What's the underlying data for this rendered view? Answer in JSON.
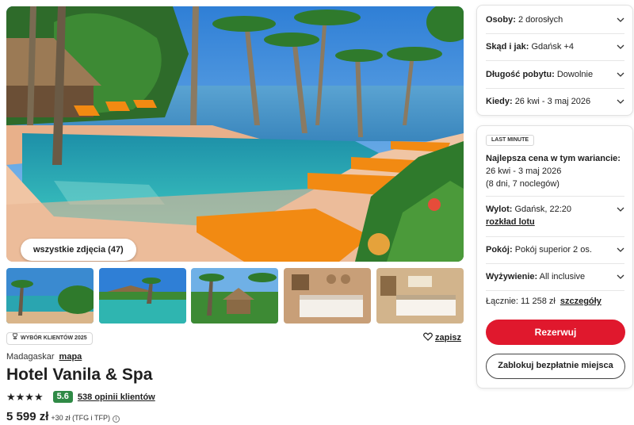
{
  "gallery": {
    "all_photos_label": "wszystkie zdjęcia (47)"
  },
  "badge": {
    "label": "WYBÓR KLIENTÓW 2025",
    "icon": "trophy-icon"
  },
  "save": {
    "label": "zapisz",
    "icon": "heart-icon"
  },
  "location": {
    "country": "Madagaskar",
    "map_link": "mapa"
  },
  "hotel": {
    "name": "Hotel Vanila & Spa",
    "stars": 4,
    "stars_text": "★★★★",
    "score": "5.6",
    "reviews_label": "538 opinii klientów"
  },
  "price": {
    "main": "5 599 zł",
    "extra": "+30 zł (TFG i TFP)",
    "info_icon": "info-icon"
  },
  "search": {
    "rows": [
      {
        "label": "Osoby:",
        "value": "2 dorosłych"
      },
      {
        "label": "Skąd i jak:",
        "value": "Gdańsk +4"
      },
      {
        "label": "Długość pobytu:",
        "value": "Dowolnie"
      },
      {
        "label": "Kiedy:",
        "value": "26 kwi - 3 maj 2026"
      }
    ]
  },
  "offer": {
    "tag": "LAST MINUTE",
    "best_heading": "Najlepsza cena w tym wariancie:",
    "dates": "26 kwi - 3 maj 2026",
    "nights": "(8 dni, 7 noclegów)",
    "flight_label": "Wylot:",
    "flight_value": "Gdańsk, 22:20",
    "flight_schedule_link": "rozkład lotu",
    "room_label": "Pokój:",
    "room_value": "Pokój superior 2 os.",
    "board_label": "Wyżywienie:",
    "board_value": "All inclusive",
    "total_label": "Łącznie: 11 258 zł",
    "details_link": "szczegóły",
    "reserve_button": "Rezerwuj",
    "hold_button": "Zablokuj bezpłatnie miejsca"
  },
  "colors": {
    "primary": "#e0182d",
    "score_bg": "#2f8a46",
    "pool": "#2fb5b0",
    "lounger": "#f28a12"
  }
}
